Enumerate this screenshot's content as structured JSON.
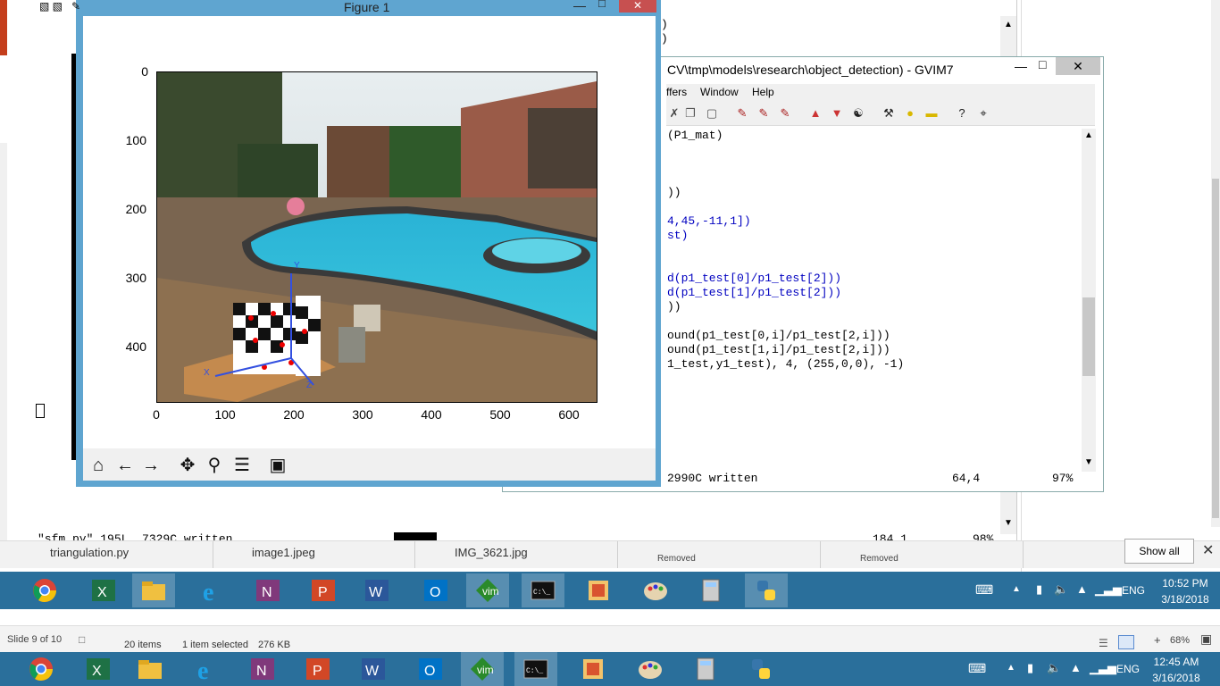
{
  "figure": {
    "title": "Figure 1",
    "y_ticks": [
      "0",
      "100",
      "200",
      "300",
      "400"
    ],
    "x_ticks": [
      "0",
      "100",
      "200",
      "300",
      "400",
      "500",
      "600"
    ],
    "axis_labels": {
      "x_axis": "X",
      "y_axis": "Y",
      "z_axis": "Z"
    },
    "toolbar": [
      "home-icon",
      "back-icon",
      "forward-icon",
      "pan-icon",
      "zoom-icon",
      "configure-icon",
      "save-icon"
    ]
  },
  "gvim_small": {
    "title": "CV\\tmp\\models\\research\\object_detection) - GVIM7",
    "menu": [
      "ffers",
      "Window",
      "Help"
    ],
    "lines": [
      {
        "text": "(P1_mat)",
        "cls": ""
      },
      {
        "text": "",
        "cls": ""
      },
      {
        "text": "",
        "cls": ""
      },
      {
        "text": "))",
        "cls": ""
      },
      {
        "text": "",
        "cls": ""
      },
      {
        "text": "4,45,-11,1])",
        "cls": "blue"
      },
      {
        "text": "st)",
        "cls": "blue"
      },
      {
        "text": "",
        "cls": ""
      },
      {
        "text": "",
        "cls": ""
      },
      {
        "text": "d(p1_test[0]/p1_test[2]))",
        "cls": "blue"
      },
      {
        "text": "d(p1_test[1]/p1_test[2]))",
        "cls": "blue"
      },
      {
        "text": "))",
        "cls": ""
      },
      {
        "text": "",
        "cls": ""
      },
      {
        "text": "ound(p1_test[0,i]/p1_test[2,i]))",
        "cls": ""
      },
      {
        "text": "ound(p1_test[1,i]/p1_test[2,i]))",
        "cls": ""
      },
      {
        "text": "1_test,y1_test), 4, (255,0,0), -1)",
        "cls": ""
      }
    ],
    "status_left": "2990C written",
    "status_pos": "64,4",
    "status_pct": "97%"
  },
  "gvim_big": {
    "status_left": "\"sfm.py\" 195L, 7329C written",
    "status_pos": "184,1",
    "status_pct": "98%",
    "top_fragments": [
      ")",
      ")"
    ]
  },
  "notifications": {
    "items": [
      {
        "name": "triangulation.py",
        "sub": ""
      },
      {
        "name": "image1.jpeg",
        "sub": ""
      },
      {
        "name": "IMG_3621.jpg",
        "sub": ""
      },
      {
        "name": "",
        "sub": "Removed"
      },
      {
        "name": "",
        "sub": "Removed"
      }
    ],
    "show_all": "Show all"
  },
  "taskbar_top": {
    "apps": [
      "chrome-icon",
      "excel-icon",
      "file-explorer-icon",
      "ie-icon",
      "onenote-icon",
      "powerpoint-icon",
      "word-icon",
      "outlook-icon",
      "vim-icon",
      "cmd-icon",
      "snipping-icon",
      "paint-icon",
      "calculator-icon",
      "python-icon"
    ],
    "lang": "ENG",
    "time": "10:52 PM",
    "date": "3/18/2018"
  },
  "ppt_status": {
    "slide": "Slide 9 of 10",
    "items": "20 items",
    "selected": "1 item selected",
    "size": "276 KB",
    "zoom": "68%"
  },
  "taskbar_bottom": {
    "lang": "ENG",
    "time": "12:45 AM",
    "date": "3/16/2018"
  },
  "colors": {
    "taskbar": "#2a6f9b",
    "figure_border": "#5fa5d0",
    "code_blue": "#0000c0",
    "code_magenta": "#d000d0"
  }
}
